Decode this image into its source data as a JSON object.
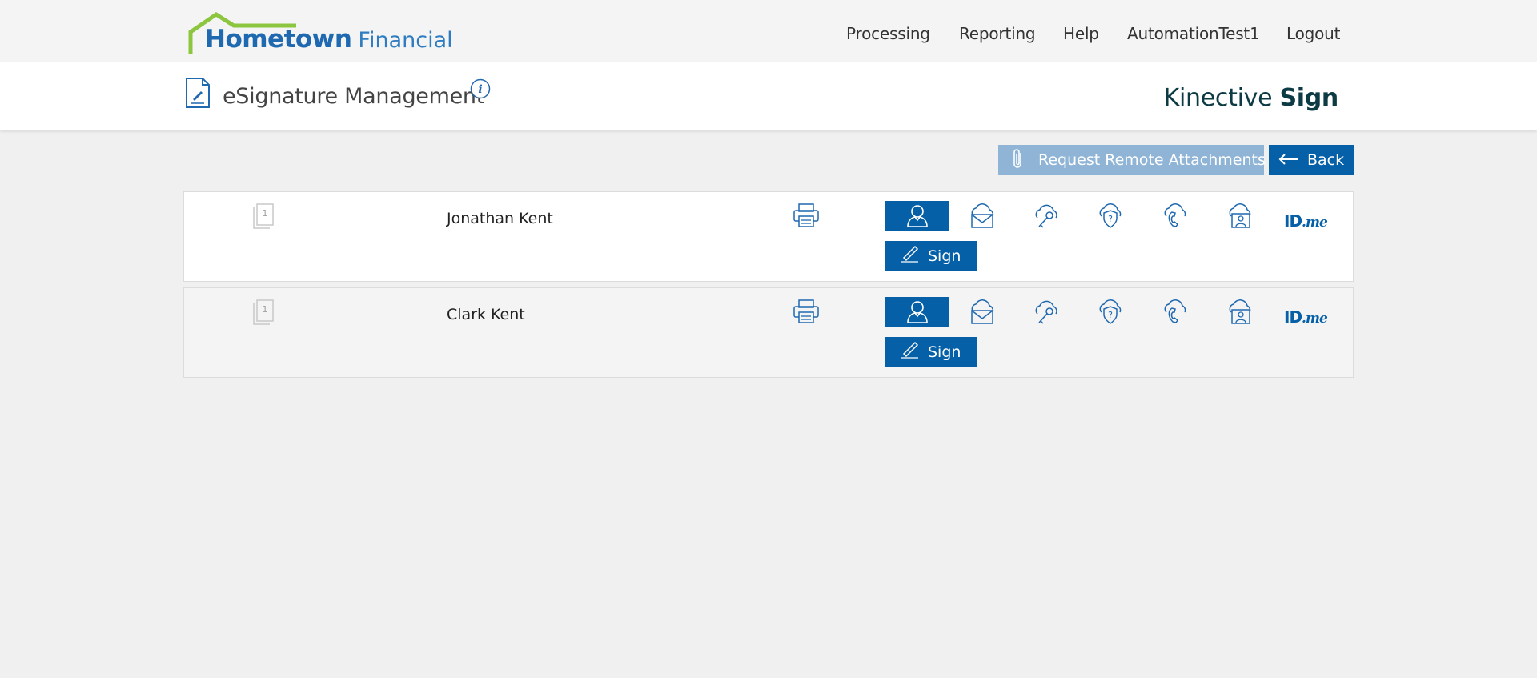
{
  "header": {
    "logo": {
      "brand_bold": "Hometown",
      "brand_light": "Financial"
    },
    "nav": [
      {
        "label": "Processing"
      },
      {
        "label": "Reporting"
      },
      {
        "label": "Help"
      },
      {
        "label": "AutomationTest1"
      },
      {
        "label": "Logout"
      }
    ]
  },
  "subheader": {
    "title": "eSignature Management",
    "brand_light": "Kinective ",
    "brand_bold": "Sign"
  },
  "actions": {
    "attach_label": "Request Remote Attachments",
    "back_label": "Back"
  },
  "signers": [
    {
      "name": "Jonathan Kent",
      "doc_count": "1",
      "sign_label": "Sign",
      "idme_id": "ID",
      "idme_me": ".me"
    },
    {
      "name": "Clark Kent",
      "doc_count": "1",
      "sign_label": "Sign",
      "idme_id": "ID",
      "idme_me": ".me"
    }
  ],
  "colors": {
    "primary": "#0560a8",
    "primary_disabled": "#8fb4d6",
    "logo_green": "#8cc63f",
    "brand_text": "#0d3b44"
  },
  "icons": {
    "row": [
      "document-count-icon",
      "printer-icon",
      "person-icon",
      "cloud-email-icon",
      "cloud-key-icon",
      "cloud-question-icon",
      "cloud-phone-icon",
      "cloud-id-card-icon",
      "idme-logo"
    ]
  }
}
